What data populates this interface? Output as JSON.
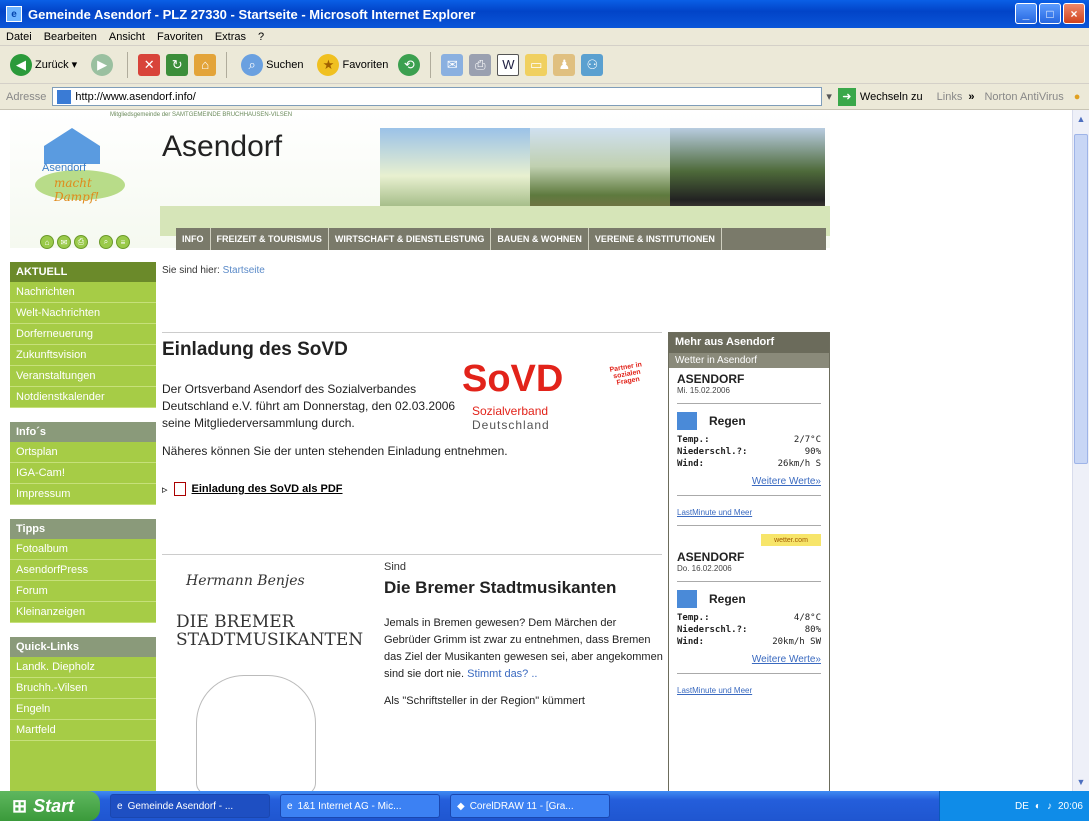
{
  "window": {
    "title": "Gemeinde Asendorf - PLZ 27330 - Startseite - Microsoft Internet Explorer",
    "menu": [
      "Datei",
      "Bearbeiten",
      "Ansicht",
      "Favoriten",
      "Extras",
      "?"
    ],
    "toolbar": {
      "back": "Zurück",
      "search": "Suchen",
      "favorites": "Favoriten"
    },
    "address_label": "Adresse",
    "url": "http://www.asendorf.info/",
    "go_label": "Wechseln zu",
    "links_label": "Links",
    "norton_label": "Norton AntiVirus"
  },
  "site": {
    "tagline": "Mitgliedsgemeinde der SAMTGEMEINDE BRUCHHAUSEN-VILSEN",
    "title": "Asendorf",
    "logo_text1": "Asendorf",
    "logo_text2": "macht Dampf!",
    "nav": [
      "INFO",
      "FREIZEIT & TOURISMUS",
      "WIRTSCHAFT & DIENSTLEISTUNG",
      "BAUEN & WOHNEN",
      "VEREINE & INSTITUTIONEN"
    ],
    "breadcrumb_label": "Sie sind hier:",
    "breadcrumb_link": "Startseite"
  },
  "leftnav": {
    "sections": [
      {
        "head": "AKTUELL",
        "items": [
          "Nachrichten",
          "Welt-Nachrichten",
          "Dorferneuerung",
          "Zukunftsvision",
          "Veranstaltungen",
          "Notdienstkalender"
        ]
      },
      {
        "head": "Info´s",
        "items": [
          "Ortsplan",
          "IGA-Cam!",
          "Impressum"
        ]
      },
      {
        "head": "Tipps",
        "items": [
          "Fotoalbum",
          "AsendorfPress",
          "Forum",
          "Kleinanzeigen"
        ]
      },
      {
        "head": "Quick-Links",
        "items": [
          "Landk. Diepholz",
          "Bruchh.-Vilsen",
          "Engeln",
          "Martfeld"
        ]
      }
    ]
  },
  "article1": {
    "title": "Einladung des SoVD",
    "text": "Der Ortsverband Asendorf des Sozialverbandes Deutschland e.V. führt am Donnerstag, den 02.03.2006 seine Mitgliederversammlung durch.",
    "text2": "Näheres können Sie der unten stehenden Einladung entnehmen.",
    "pdf_link": "Einladung des SoVD als PDF",
    "logo_big": "SoVD",
    "logo_sub1": "Sozialverband",
    "logo_sub2": "Deutschland",
    "logo_badge": "Partner in sozialen Fragen"
  },
  "article2": {
    "book_author": "Hermann Benjes",
    "book_title": "DIE BREMER STADTMUSIKANTEN",
    "kicker": "Sind",
    "title": "Die Bremer Stadtmusikanten",
    "text": "Jemals in Bremen gewesen? Dem Märchen der Gebrüder Grimm ist zwar zu entnehmen, dass Bremen das Ziel der Musikanten gewesen sei, aber angekommen sind sie dort nie.",
    "link": "Stimmt das? ..",
    "trail": "Als \"Schriftsteller in der Region\" kümmert"
  },
  "sidebar": {
    "head": "Mehr aus Asendorf",
    "sub": "Wetter in Asendorf",
    "weather": [
      {
        "city": "ASENDORF",
        "date": "Mi. 15.02.2006",
        "cond": "Regen",
        "temp_label": "Temp.:",
        "temp": "2/7°C",
        "rain_label": "Niederschl.?:",
        "rain": "90%",
        "wind_label": "Wind:",
        "wind": "26km/h S",
        "more": "Weitere Werte»",
        "link": "LastMinute und Meer"
      },
      {
        "city": "ASENDORF",
        "date": "Do. 16.02.2006",
        "cond": "Regen",
        "temp_label": "Temp.:",
        "temp": "4/8°C",
        "rain_label": "Niederschl.?:",
        "rain": "80%",
        "wind_label": "Wind:",
        "wind": "20km/h SW",
        "more": "Weitere Werte»",
        "link": "LastMinute und Meer"
      }
    ],
    "badge": "wetter.com"
  },
  "taskbar": {
    "start": "Start",
    "tasks": [
      "Gemeinde Asendorf - ...",
      "1&1 Internet AG - Mic...",
      "CorelDRAW 11 - [Gra..."
    ],
    "lang": "DE",
    "clock": "20:06"
  }
}
